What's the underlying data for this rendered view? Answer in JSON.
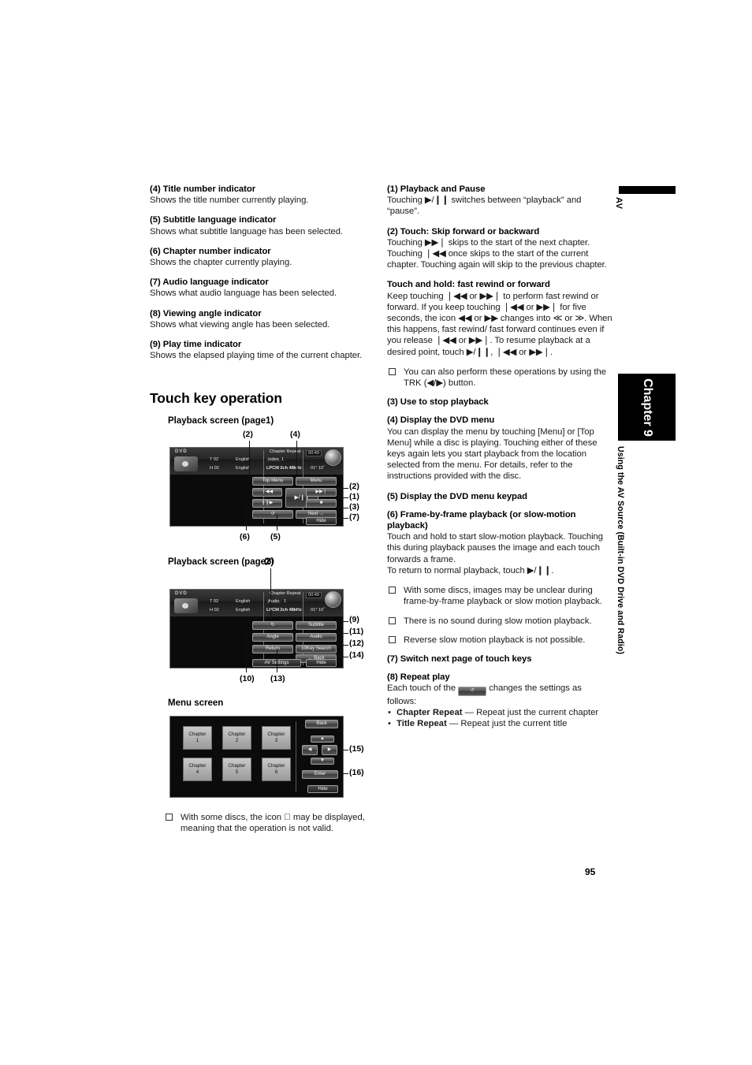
{
  "page": {
    "number": "95",
    "side_tab_av": "AV",
    "side_tab_chapter": "Chapter 9",
    "side_tab_running": "Using the AV Source (Built-in DVD Drive and Radio)"
  },
  "left_column": {
    "items": [
      {
        "heading": "(4) Title number indicator",
        "body": "Shows the title number currently playing."
      },
      {
        "heading": "(5) Subtitle language indicator",
        "body": "Shows what subtitle language has been selected."
      },
      {
        "heading": "(6) Chapter number indicator",
        "body": "Shows the chapter currently playing."
      },
      {
        "heading": "(7) Audio language indicator",
        "body": "Shows what audio language has been selected."
      },
      {
        "heading": "(8) Viewing angle indicator",
        "body": "Shows what viewing angle has been selected."
      },
      {
        "heading": "(9) Play time indicator",
        "body": "Shows the elapsed playing time of the current chapter."
      }
    ],
    "section_title": "Touch key operation",
    "fig1_caption": "Playback screen (page1)",
    "fig2_caption": "Playback screen (page2)",
    "fig3_caption": "Menu screen",
    "note": "With some discs, the icon ⃠ may be displayed, meaning that the operation is not valid."
  },
  "right_column": {
    "b1_heading": "(1) Playback and Pause",
    "b1_body": "Touching ▶/❙❙ switches between “playback” and “pause”.",
    "b2_heading": "(2) Touch: Skip forward or backward",
    "b2_body": "Touching ▶▶❘ skips to the start of the next chapter. Touching ❘◀◀ once skips to the start of the current chapter. Touching again will skip to the previous chapter.",
    "b3_heading": "Touch and hold: fast rewind or forward",
    "b3_body": "Keep touching ❘◀◀ or ▶▶❘ to perform fast rewind or forward. If you keep touching ❘◀◀ or ▶▶❘ for five seconds, the icon ◀◀ or ▶▶ changes into ≪ or ≫. When this happens, fast rewind/ fast forward continues even if you release ❘◀◀ or ▶▶❘. To resume playback at a desired point, touch ▶/❙❙, ❘◀◀ or ▶▶❘.",
    "note1": "You can also perform these operations by using the TRK (◀/▶) button.",
    "note1_bold": "TRK (◀/▶)",
    "b4_heading": "(3) Use to stop playback",
    "b5_heading": "(4) Display the DVD menu",
    "b5_body": "You can display the menu by touching [Menu] or [Top Menu] while a disc is playing. Touching either of these keys again lets you start playback from the location selected from the menu. For details, refer to the instructions provided with the disc.",
    "b6_heading": "(5) Display the DVD menu keypad",
    "b7_heading": "(6) Frame-by-frame playback (or slow-motion playback)",
    "b7_body": "Touch and hold to start slow-motion playback. Touching this during playback pauses the image and each touch forwards a frame.",
    "b7_body2": "To return to normal playback, touch ▶/❙❙.",
    "note2": "With some discs, images may be unclear during frame-by-frame playback or slow motion playback.",
    "note3": "There is no sound during slow motion playback.",
    "note4": "Reverse slow motion playback is not possible.",
    "b8_heading": "(7) Switch next page of touch keys",
    "b9_heading": "(8) Repeat play",
    "b9_body_pre": "Each touch of the",
    "b9_body_post": "changes the settings as follows:",
    "bullet1_bold": "Chapter Repeat",
    "bullet1_rest": " — Repeat just the current chapter",
    "bullet2_bold": "Title Repeat",
    "bullet2_rest": " — Repeat just the current title"
  },
  "figure1": {
    "label": "Playback screen (page1)",
    "source": "DVD",
    "title_row": "T  02",
    "subtitle_row": "English",
    "chapter_row": "H  02",
    "audio_row": "English",
    "repeat_mode": "Chapter Repeat",
    "index_label": "Index",
    "index_value": "1",
    "audio_format": "LPCM 2ch 48kHz",
    "clock": "00:49",
    "play_time": "01° 10˝",
    "keys": {
      "top_menu": "Top Menu",
      "menu": "Menu",
      "prev": "❘◀◀",
      "play_pause": "▶/❙❙",
      "next": "▶▶❘",
      "slow": "❙❙▶",
      "stop": "■",
      "keypad": "↺",
      "next_page": "Next →",
      "hide": "Hide"
    },
    "callouts": [
      "(2)",
      "(4)",
      "(2)",
      "(1)",
      "(3)",
      "(7)",
      "(6)",
      "(5)"
    ]
  },
  "figure2": {
    "label": "Playback screen (page2)",
    "source": "DVD",
    "title_row": "T  02",
    "subtitle_row": "English",
    "chapter_row": "H  02",
    "audio_row": "English",
    "repeat_mode": "Chapter Repeat",
    "index_label": "Audio",
    "index_value": "1",
    "audio_format": "LPCM 2ch 48kHz",
    "clock": "00:49",
    "play_time": "01° 10˝",
    "keys": {
      "repeat": "↻",
      "subtitle": "Subtitle",
      "angle": "Angle",
      "audio": "Audio",
      "return": "Return",
      "keysearch": "10Key Search",
      "back": "← Back",
      "av_settings": "AV Settings",
      "hide": "Hide"
    },
    "callouts": [
      "(8)",
      "(9)",
      "(11)",
      "(12)",
      "(14)",
      "(10)",
      "(13)"
    ]
  },
  "figure3": {
    "label": "Menu screen",
    "chapters": [
      {
        "name": "Chapter",
        "num": "1"
      },
      {
        "name": "Chapter",
        "num": "2"
      },
      {
        "name": "Chapter",
        "num": "3"
      },
      {
        "name": "Chapter",
        "num": "4"
      },
      {
        "name": "Chapter",
        "num": "5"
      },
      {
        "name": "Chapter",
        "num": "6"
      }
    ],
    "keys": {
      "back": "Back",
      "up": "▲",
      "left": "◀",
      "right": "▶",
      "down": "▼",
      "enter": "Enter",
      "hide": "Hide"
    },
    "callouts": [
      "(15)",
      "(16)"
    ]
  }
}
